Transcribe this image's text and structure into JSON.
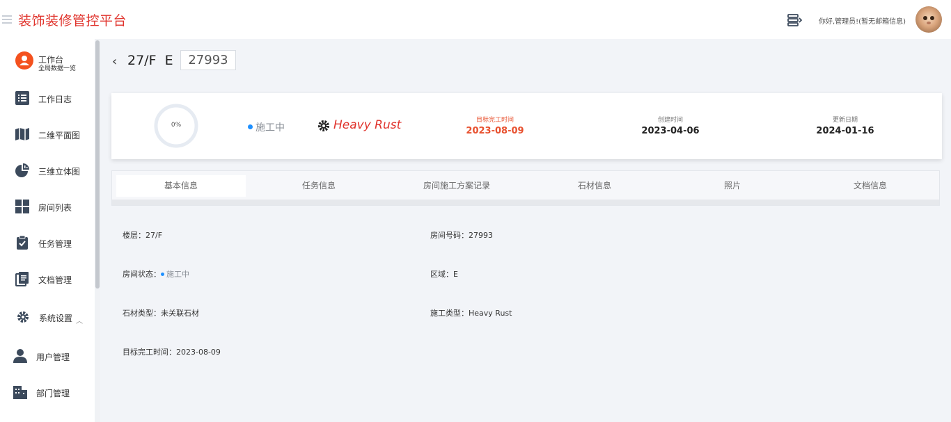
{
  "header": {
    "brand": "装饰装修管控平台",
    "greeting": "你好,管理员!(暂无邮箱信息)"
  },
  "sidebar": {
    "workspace": {
      "title": "工作台",
      "subtitle": "全局数据一览"
    },
    "items": [
      {
        "label": "工作日志",
        "icon": "list-icon"
      },
      {
        "label": "二维平面图",
        "icon": "map-icon"
      },
      {
        "label": "三维立体图",
        "icon": "pie-chart-icon"
      },
      {
        "label": "房间列表",
        "icon": "grid-icon"
      },
      {
        "label": "任务管理",
        "icon": "clipboard-check-icon"
      },
      {
        "label": "文档管理",
        "icon": "document-icon"
      },
      {
        "label": "系统设置",
        "icon": "gear-icon"
      },
      {
        "label": "用户管理",
        "icon": "user-icon"
      },
      {
        "label": "部门管理",
        "icon": "building-icon"
      }
    ]
  },
  "room": {
    "floor_title": "27/F  E",
    "room_number": "27993"
  },
  "summary": {
    "progress": "0%",
    "progress_value": 0,
    "status": "施工中",
    "construction_type": "Heavy Rust",
    "target_label": "目标完工时间",
    "target_date": "2023-08-09",
    "created_label": "创建时间",
    "created_date": "2023-04-06",
    "updated_label": "更新日期",
    "updated_date": "2024-01-16"
  },
  "tabs": [
    "基本信息",
    "任务信息",
    "房间施工方案记录",
    "石材信息",
    "照片",
    "文档信息"
  ],
  "info": {
    "floor_label": "楼层：",
    "floor_value": "27/F",
    "room_label": "房间号码：",
    "room_value": "27993",
    "status_label": "房间状态：",
    "status_value": "施工中",
    "area_label": "区域：",
    "area_value": "E",
    "stone_label": "石材类型：",
    "stone_value": "未关联石材",
    "ctype_label": "施工类型：",
    "ctype_value": "Heavy Rust",
    "target_label": "目标完工时间：",
    "target_value": "2023-08-09"
  },
  "colors": {
    "brand": "#e0332c",
    "accent": "#1e90ff",
    "target": "#e8502e"
  }
}
